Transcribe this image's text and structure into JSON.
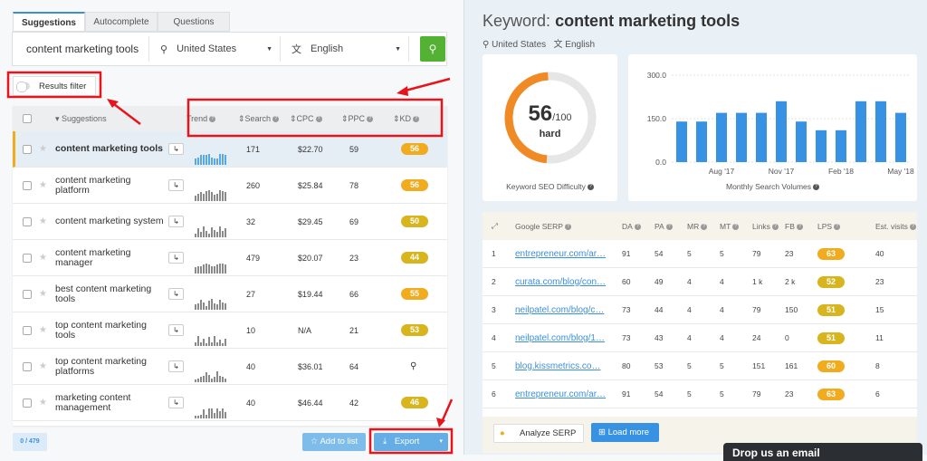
{
  "tabs": [
    "Suggestions",
    "Autocomplete",
    "Questions"
  ],
  "search": {
    "keyword": "content marketing tools",
    "location": "United States",
    "language": "English"
  },
  "filter_label": "Results filter",
  "left_table": {
    "headers": {
      "suggestions": "Suggestions",
      "trend": "Trend",
      "search": "Search",
      "cpc": "CPC",
      "ppc": "PPC",
      "kd": "KD"
    },
    "rows": [
      {
        "kw": "content marketing tools",
        "search": "171",
        "cpc": "$22.70",
        "ppc": "59",
        "kd": "56",
        "kd_color": "#f0ab1f",
        "trend": [
          5,
          6,
          8,
          8,
          8,
          9,
          6,
          5,
          5,
          9,
          9,
          8
        ]
      },
      {
        "kw": "content marketing platform",
        "search": "260",
        "cpc": "$25.84",
        "ppc": "78",
        "kd": "56",
        "kd_color": "#f0ab1f",
        "trend": [
          4,
          6,
          7,
          6,
          8,
          9,
          7,
          5,
          6,
          9,
          8,
          7
        ]
      },
      {
        "kw": "content marketing system",
        "search": "32",
        "cpc": "$29.45",
        "ppc": "69",
        "kd": "50",
        "kd_color": "#d8b41e",
        "trend": [
          3,
          7,
          4,
          9,
          5,
          3,
          8,
          6,
          4,
          9,
          5,
          7
        ]
      },
      {
        "kw": "content marketing manager",
        "search": "479",
        "cpc": "$20.07",
        "ppc": "23",
        "kd": "44",
        "kd_color": "#d8b41e",
        "trend": [
          5,
          6,
          6,
          7,
          8,
          7,
          6,
          6,
          7,
          8,
          8,
          7
        ]
      },
      {
        "kw": "best content marketing tools",
        "search": "27",
        "cpc": "$19.44",
        "ppc": "66",
        "kd": "55",
        "kd_color": "#f0ab1f",
        "trend": [
          4,
          5,
          8,
          6,
          3,
          7,
          9,
          5,
          4,
          8,
          6,
          5
        ]
      },
      {
        "kw": "top content marketing tools",
        "search": "10",
        "cpc": "N/A",
        "ppc": "21",
        "kd": "53",
        "kd_color": "#d8b41e",
        "trend": [
          3,
          8,
          3,
          6,
          2,
          7,
          3,
          8,
          3,
          5,
          2,
          6
        ]
      },
      {
        "kw": "top content marketing platforms",
        "search": "40",
        "cpc": "$36.01",
        "ppc": "64",
        "kd": "",
        "kd_color": "",
        "trend": [
          2,
          3,
          4,
          5,
          8,
          6,
          3,
          4,
          9,
          5,
          4,
          3
        ]
      },
      {
        "kw": "marketing content management",
        "search": "40",
        "cpc": "$46.44",
        "ppc": "42",
        "kd": "46",
        "kd_color": "#d8b41e",
        "trend": [
          2,
          2,
          3,
          7,
          3,
          8,
          8,
          4,
          8,
          6,
          8,
          5
        ]
      }
    ]
  },
  "footer": {
    "count": "0 / 479",
    "add_to_list": "Add to list",
    "export": "Export"
  },
  "keyword": {
    "label": "Keyword:",
    "value": "content marketing tools",
    "location": "United States",
    "language": "English"
  },
  "difficulty": {
    "score": "56",
    "max": "/100",
    "level": "hard",
    "label": "Keyword SEO Difficulty",
    "fraction": 0.56,
    "color": "#f08a24"
  },
  "chart_data": {
    "type": "bar",
    "title": "Monthly Search Volumes",
    "ylim": [
      0,
      300
    ],
    "yticks": [
      "300.0",
      "150.0",
      "0.0"
    ],
    "xticks": [
      "Aug '17",
      "Nov '17",
      "Feb '18",
      "May '18"
    ],
    "values": [
      140,
      140,
      170,
      170,
      170,
      210,
      140,
      110,
      110,
      210,
      210,
      170
    ],
    "color": "#3892e3"
  },
  "serp": {
    "headers": [
      "Google SERP",
      "DA",
      "PA",
      "MR",
      "MT",
      "Links",
      "FB",
      "LPS",
      "Est. visits"
    ],
    "rows": [
      {
        "n": "1",
        "url": "entrepreneur.com/ar…",
        "da": "91",
        "pa": "54",
        "mr": "5",
        "mt": "5",
        "links": "79",
        "fb": "23",
        "lps": "63",
        "lps_color": "#f0ab1f",
        "visits": "40"
      },
      {
        "n": "2",
        "url": "curata.com/blog/con…",
        "da": "60",
        "pa": "49",
        "mr": "4",
        "mt": "4",
        "links": "1 k",
        "fb": "2 k",
        "lps": "52",
        "lps_color": "#d8b41e",
        "visits": "23"
      },
      {
        "n": "3",
        "url": "neilpatel.com/blog/c…",
        "da": "73",
        "pa": "44",
        "mr": "4",
        "mt": "4",
        "links": "79",
        "fb": "150",
        "lps": "51",
        "lps_color": "#d8b41e",
        "visits": "15"
      },
      {
        "n": "4",
        "url": "neilpatel.com/blog/1…",
        "da": "73",
        "pa": "43",
        "mr": "4",
        "mt": "4",
        "links": "24",
        "fb": "0",
        "lps": "51",
        "lps_color": "#d8b41e",
        "visits": "11"
      },
      {
        "n": "5",
        "url": "blog.kissmetrics.co…",
        "da": "80",
        "pa": "53",
        "mr": "5",
        "mt": "5",
        "links": "151",
        "fb": "161",
        "lps": "60",
        "lps_color": "#f0ab1f",
        "visits": "8"
      },
      {
        "n": "6",
        "url": "entrepreneur.com/ar…",
        "da": "91",
        "pa": "54",
        "mr": "5",
        "mt": "5",
        "links": "79",
        "fb": "23",
        "lps": "63",
        "lps_color": "#f0ab1f",
        "visits": "6"
      }
    ],
    "analyze": "Analyze SERP",
    "load_more": "Load more"
  },
  "popup": "Drop us an email"
}
